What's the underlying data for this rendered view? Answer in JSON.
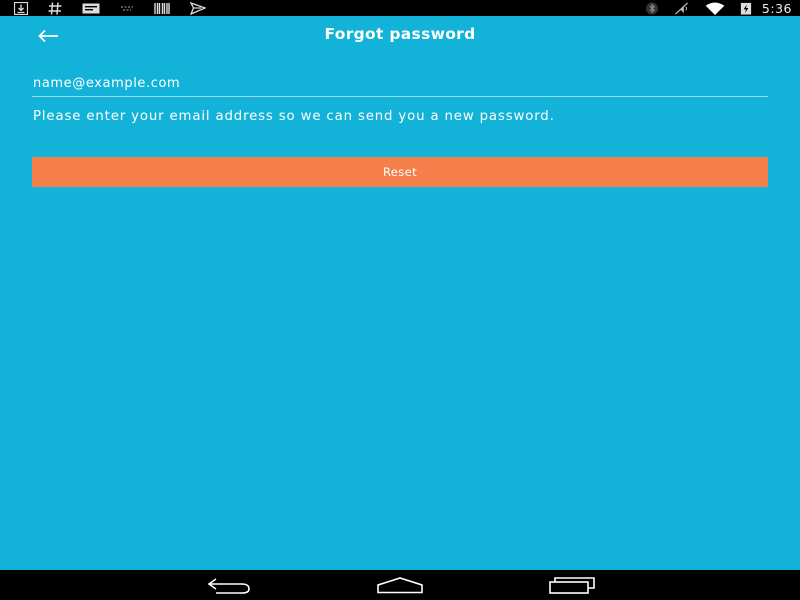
{
  "status_bar": {
    "time": "5:36",
    "left_icons": [
      "download-icon",
      "hashtag-icon",
      "message-icon",
      "signal-dots-icon",
      "barcode-icon",
      "send-icon"
    ],
    "right_icons": [
      "bluetooth-icon",
      "vibrate-icon",
      "wifi-icon",
      "battery-charging-icon"
    ]
  },
  "header": {
    "title": "Forgot password",
    "back_icon": "arrow-left-icon"
  },
  "form": {
    "email_placeholder": "name@example.com",
    "email_value": "",
    "instructions": "Please enter your email address so we can send you a new password.",
    "reset_label": "Reset"
  },
  "nav_bar": {
    "icons": [
      "back-nav-icon",
      "home-nav-icon",
      "recents-nav-icon"
    ]
  },
  "colors": {
    "background": "#13b3d9",
    "button": "#f47f4a",
    "text": "#ffffff"
  }
}
